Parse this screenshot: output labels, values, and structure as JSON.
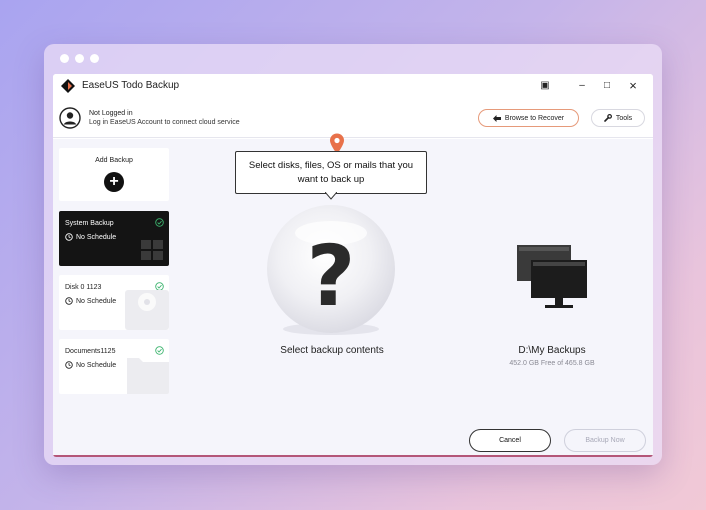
{
  "app": {
    "title": "EaseUS Todo Backup",
    "window_controls": {
      "restore": "▣",
      "minimize": "–",
      "maximize": "□",
      "close": "×"
    }
  },
  "account": {
    "status": "Not Logged in",
    "hint": "Log in EaseUS Account to connect cloud service"
  },
  "toolbar": {
    "browse_label": "Browse to Recover",
    "tools_label": "Tools"
  },
  "sidebar": {
    "add_backup_label": "Add Backup",
    "add_symbol": "+",
    "cards": [
      {
        "name": "System Backup",
        "schedule": "No Schedule",
        "theme": "dark",
        "icon": "windows-icon"
      },
      {
        "name": "Disk 0 1123",
        "schedule": "No Schedule",
        "theme": "light",
        "icon": "disk-icon"
      },
      {
        "name": "Documents1125",
        "schedule": "No Schedule",
        "theme": "light",
        "icon": "folder-icon"
      }
    ]
  },
  "source": {
    "tooltip": "Select disks, files, OS or mails that you want to back up",
    "label": "Select backup contents",
    "symbol": "?"
  },
  "destination": {
    "path": "D:\\My Backups",
    "free_space": "452.0 GB Free of 465.8 GB"
  },
  "actions": {
    "cancel_label": "Cancel",
    "backup_now_label": "Backup Now"
  },
  "colors": {
    "accent": "#e8714a",
    "check_green": "#3cb46e",
    "dark_card": "#141414",
    "bottom_line": "#b45678"
  }
}
